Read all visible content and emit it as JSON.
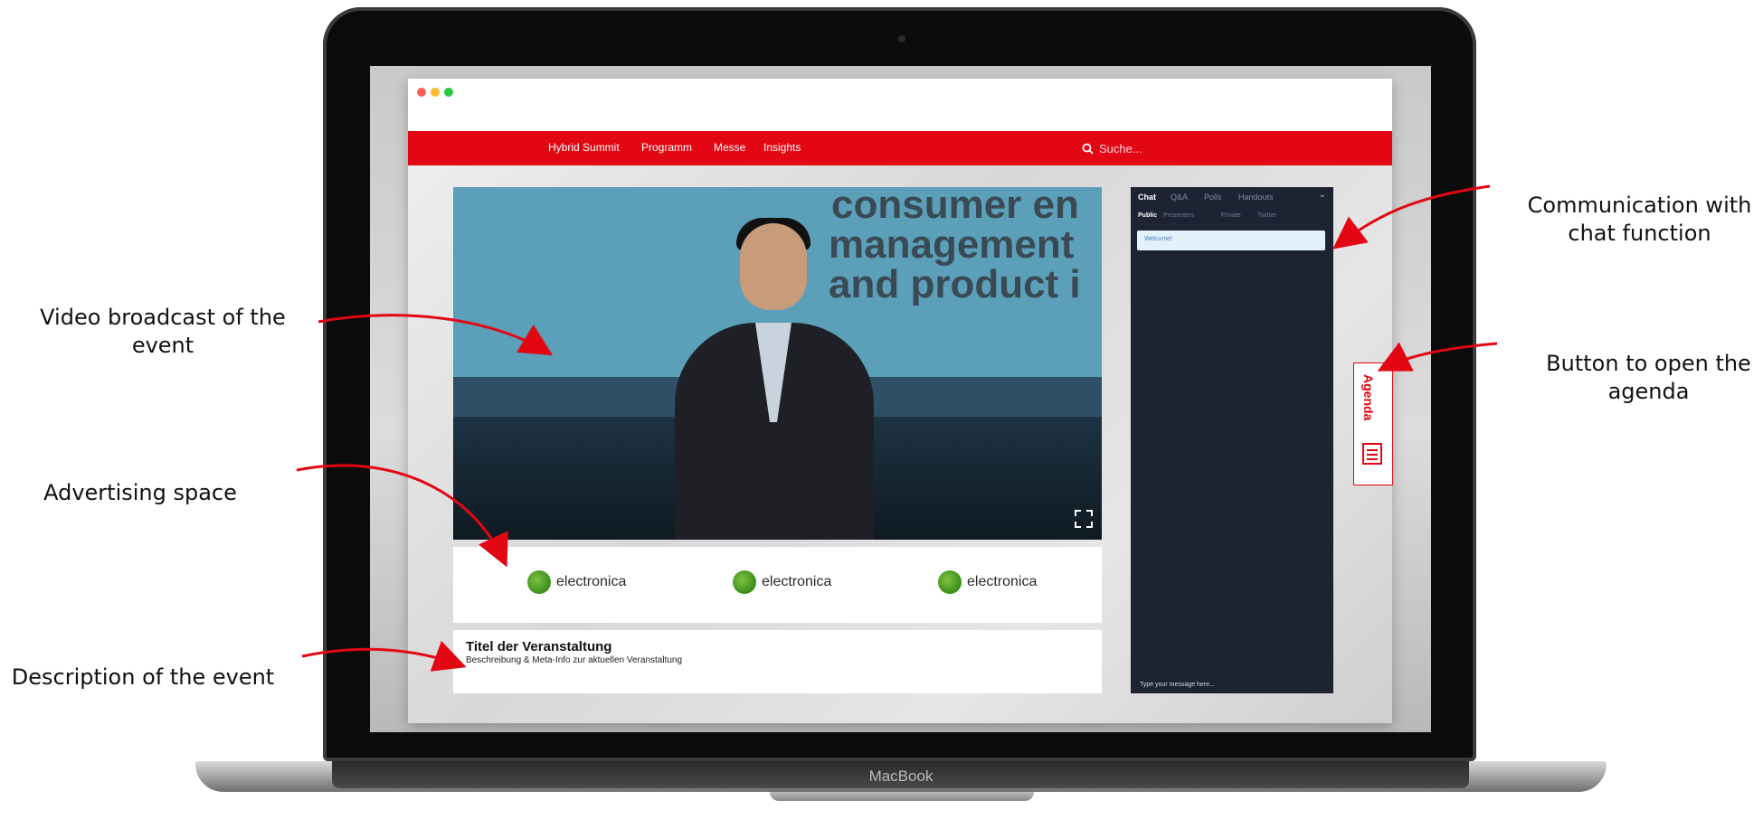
{
  "annotations": {
    "video": "Video broadcast of the event",
    "ads": "Advertising space",
    "description": "Description of the event",
    "chat": "Communication with chat function",
    "agenda": "Button to open the agenda"
  },
  "app": {
    "nav": [
      "Hybrid Summit",
      "Programm",
      "Messe",
      "Insights"
    ],
    "search_placeholder": "Suche...",
    "video_slide_text": [
      "consumer en",
      "management",
      "and product i"
    ],
    "ads": [
      "electronica",
      "electronica",
      "electronica"
    ],
    "event_title": "Titel der Veranstaltung",
    "event_description": "Beschreibung & Meta-Info zur aktuellen Veranstaltung",
    "chat": {
      "tabs": [
        "Chat",
        "Q&A",
        "Polls",
        "Handouts"
      ],
      "subtabs": [
        "Public",
        "Presenters",
        "Private",
        "Twitter"
      ],
      "message": "Welcome!",
      "input_placeholder": "Type your message here..."
    },
    "agenda_label": "Agenda"
  },
  "device": {
    "brand": "MacBook"
  },
  "colors": {
    "accent": "#e30613",
    "chat_bg": "#1d2333",
    "ad_logo": "#3a8d1c"
  },
  "icons": {
    "search": "search-icon",
    "fullscreen": "fullscreen-icon",
    "agenda": "calendar-icon",
    "chat_collapse": "chevron-down-icon"
  }
}
